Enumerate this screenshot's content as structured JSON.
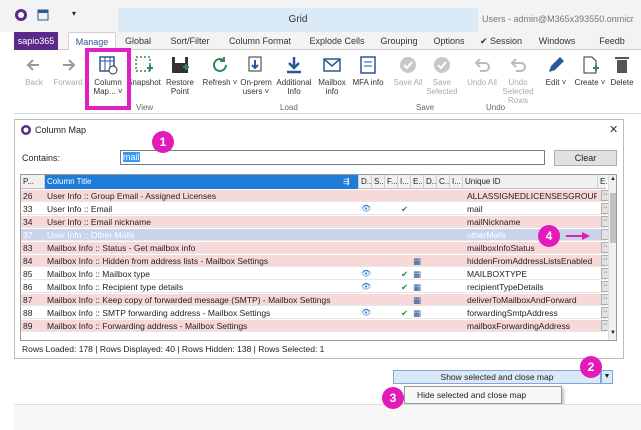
{
  "window": {
    "grid_label": "Grid",
    "user_label": "Users - admin@M365x393550.onmicr"
  },
  "tabs": [
    "sapio365",
    "Manage",
    "Global",
    "Sort/Filter",
    "Column Format",
    "Explode Cells",
    "Grouping",
    "Options",
    "✔ Session",
    "Windows",
    "Feedb"
  ],
  "ribbon": {
    "buttons": [
      {
        "label": "Back",
        "disabled": true
      },
      {
        "label": "Forward",
        "disabled": true
      },
      {
        "label": "Column Map... ˅",
        "disabled": false
      },
      {
        "label": "Snapshot",
        "disabled": false
      },
      {
        "label": "Restore Point",
        "disabled": false
      },
      {
        "label": "Refresh ˅",
        "disabled": false
      },
      {
        "label": "On-prem users ˅",
        "disabled": false
      },
      {
        "label": "Additional Info",
        "disabled": false
      },
      {
        "label": "Mailbox info",
        "disabled": false
      },
      {
        "label": "MFA info",
        "disabled": false
      },
      {
        "label": "Save All",
        "disabled": true
      },
      {
        "label": "Save Selected",
        "disabled": true
      },
      {
        "label": "Undo All",
        "disabled": true
      },
      {
        "label": "Undo Selected Rows",
        "disabled": true
      },
      {
        "label": "Edit ˅",
        "disabled": false
      },
      {
        "label": "Create ˅",
        "disabled": false
      },
      {
        "label": "Delete",
        "disabled": false
      }
    ],
    "groups": {
      "view": "View",
      "load": "Load",
      "save": "Save",
      "undo": "Undo"
    }
  },
  "dialog": {
    "title": "Column Map",
    "close": "✕",
    "contains_label": "Contains:",
    "contains_value": "mail",
    "clear_label": "Clear",
    "columns": [
      "P...",
      "Column Title",
      "D...",
      "S...",
      "F...",
      "I...",
      "E...",
      "D...",
      "C...",
      "I...",
      "Unique ID",
      "E..."
    ],
    "rows": [
      {
        "pos": "26",
        "title": "User Info :: Group Email - Assigned Licenses",
        "eye": "",
        "check": "",
        "icon": "",
        "uid": "ALLASSIGNEDLICENSESGROUPEI",
        "style": "pink"
      },
      {
        "pos": "33",
        "title": "User Info :: Email",
        "eye": "👁",
        "check": "✔",
        "icon": "",
        "uid": "mail",
        "style": "white"
      },
      {
        "pos": "34",
        "title": "User Info :: Email nickname",
        "eye": "",
        "check": "",
        "icon": "",
        "uid": "mailNickname",
        "style": "pink"
      },
      {
        "pos": "37",
        "title": "User Info :: Other Mails",
        "eye": "",
        "check": "",
        "icon": "",
        "uid": "otherMails",
        "style": "blue"
      },
      {
        "pos": "83",
        "title": "Mailbox Info :: Status - Get mailbox info",
        "eye": "",
        "check": "",
        "icon": "",
        "uid": "mailboxInfoStatus",
        "style": "pink"
      },
      {
        "pos": "84",
        "title": "Mailbox Info :: Hidden from address lists - Mailbox Settings",
        "eye": "",
        "check": "",
        "icon": "▦",
        "uid": "hiddenFromAddressListsEnabled",
        "style": "pink"
      },
      {
        "pos": "85",
        "title": "Mailbox Info :: Mailbox type",
        "eye": "👁",
        "check": "✔",
        "icon": "▦",
        "uid": "MAILBOXTYPE",
        "style": "white"
      },
      {
        "pos": "86",
        "title": "Mailbox Info :: Recipient type details",
        "eye": "👁",
        "check": "✔",
        "icon": "▦",
        "uid": "recipientTypeDetails",
        "style": "white"
      },
      {
        "pos": "87",
        "title": "Mailbox Info :: Keep copy of forwarded message (SMTP) - Mailbox Settings",
        "eye": "",
        "check": "",
        "icon": "▦",
        "uid": "deliverToMailboxAndForward",
        "style": "pink"
      },
      {
        "pos": "88",
        "title": "Mailbox Info :: SMTP forwarding address - Mailbox Settings",
        "eye": "👁",
        "check": "✔",
        "icon": "▦",
        "uid": "forwardingSmtpAddress",
        "style": "white"
      },
      {
        "pos": "89",
        "title": "Mailbox Info :: Forwarding address - Mailbox Settings",
        "eye": "",
        "check": "",
        "icon": "",
        "uid": "mailboxForwardingAddress",
        "style": "pink"
      }
    ],
    "status": "Rows Loaded: 178  |  Rows Displayed: 40  |  Rows Hidden: 138  |  Rows Selected: 1",
    "show_button": "Show selected and close map",
    "dropdown_arrow": "▼",
    "menu_item": "Hide selected and close map"
  },
  "callouts": [
    "1",
    "2",
    "3",
    "4"
  ],
  "colors": {
    "callout": "#e21aba",
    "brand_tab": "#5a2a8a",
    "selected_header": "#1e7bd7"
  }
}
